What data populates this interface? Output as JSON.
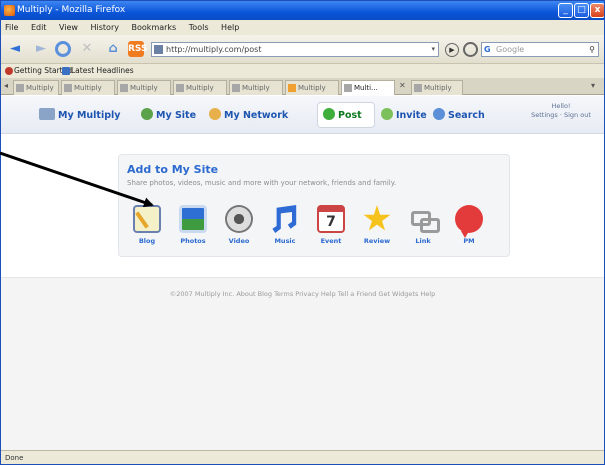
{
  "window": {
    "title": "Multiply - Mozilla Firefox",
    "minimize": "_",
    "maximize": "□",
    "close": "x"
  },
  "menubar": [
    "File",
    "Edit",
    "View",
    "History",
    "Bookmarks",
    "Tools",
    "Help"
  ],
  "navbar": {
    "back": "◄",
    "forward": "►",
    "stop": "✕",
    "home": "⌂",
    "rss": "RSS",
    "url": "http://multiply.com/post",
    "url_drop": "▾",
    "go": "▶",
    "search_engine": "G",
    "search_placeholder": "Google",
    "search_icon": "⚲"
  },
  "bookmarks": [
    "Getting Started",
    "Latest Headlines"
  ],
  "tabs": [
    "Multiply",
    "Multiply",
    "Multiply",
    "Multiply",
    "Multiply",
    "Multiply",
    "Multi...",
    "Multiply"
  ],
  "tab_controls": {
    "close": "✕",
    "list": "▾"
  },
  "site_nav": {
    "logo": "My Multiply",
    "my_site": "My Site",
    "my_network": "My Network",
    "post": "Post",
    "invite": "Invite",
    "search": "Search",
    "user_line1": "Hello!",
    "user_line2": "Settings · Sign out"
  },
  "panel": {
    "title": "Add to My Site",
    "description": "Share photos, videos, music and more with your network, friends and family.",
    "items": [
      {
        "label": "Blog",
        "icon": "blog-icon"
      },
      {
        "label": "Photos",
        "icon": "photos-icon"
      },
      {
        "label": "Video",
        "icon": "video-icon"
      },
      {
        "label": "Music",
        "icon": "music-icon"
      },
      {
        "label": "Event",
        "icon": "calendar-icon",
        "glyph": "7"
      },
      {
        "label": "Review",
        "icon": "star-icon"
      },
      {
        "label": "Link",
        "icon": "link-icon"
      },
      {
        "label": "PM",
        "icon": "speech-bubble-icon"
      }
    ]
  },
  "footer": {
    "text": "©2007 Multiply Inc.  About  Blog  Terms  Privacy  Help  Tell a Friend  Get Widgets  Help"
  },
  "status": {
    "text": "Done"
  }
}
